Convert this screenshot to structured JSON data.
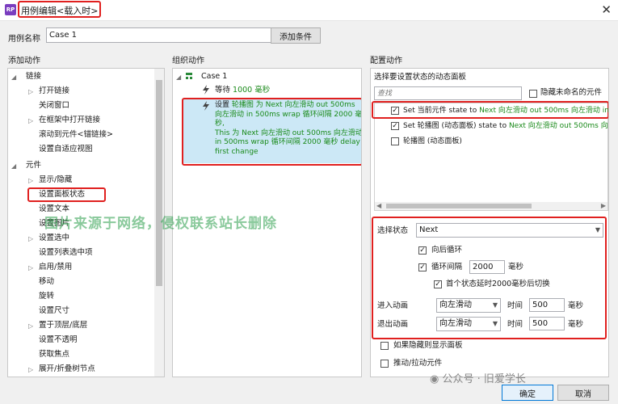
{
  "window": {
    "title": "用例编辑<载入时>",
    "app_icon": "RP",
    "close_glyph": "✕"
  },
  "case_name": {
    "label": "用例名称",
    "value": "Case 1",
    "add_condition": "添加条件"
  },
  "sections": {
    "add_action": "添加动作",
    "organize_action": "组织动作",
    "configure_action": "配置动作"
  },
  "left_tree": [
    {
      "label": "链接",
      "expand": "◢"
    },
    {
      "label": "打开链接",
      "expand": "▷"
    },
    {
      "label": "关闭窗口",
      "expand": ""
    },
    {
      "label": "在框架中打开链接",
      "expand": "▷"
    },
    {
      "label": "滚动到元件<锚链接>",
      "expand": ""
    },
    {
      "label": "设置自适应视图",
      "expand": ""
    },
    {
      "label": "元件",
      "expand": "◢"
    },
    {
      "label": "显示/隐藏",
      "expand": "▷"
    },
    {
      "label": "设置面板状态",
      "expand": ""
    },
    {
      "label": "设置文本",
      "expand": ""
    },
    {
      "label": "设置图片",
      "expand": ""
    },
    {
      "label": "设置选中",
      "expand": "▷"
    },
    {
      "label": "设置列表选中项",
      "expand": ""
    },
    {
      "label": "启用/禁用",
      "expand": "▷"
    },
    {
      "label": "移动",
      "expand": ""
    },
    {
      "label": "旋转",
      "expand": ""
    },
    {
      "label": "设置尺寸",
      "expand": ""
    },
    {
      "label": "置于顶层/底层",
      "expand": "▷"
    },
    {
      "label": "设置不透明",
      "expand": ""
    },
    {
      "label": "获取焦点",
      "expand": ""
    },
    {
      "label": "展开/折叠树节点",
      "expand": "▷"
    }
  ],
  "middle": {
    "case_label": "Case 1",
    "wait_prefix": "等待",
    "wait_value": "1000 毫秒",
    "action_line1_prefix": "设置",
    "action_line1": "轮播图 为 Next 向左滑动 out 500ms",
    "action_line2": "向左滑动 in 500ms wrap 循环间隔 2000 毫",
    "action_line3": "秒,",
    "action_line4": "This 为 Next 向左滑动 out 500ms 向左滑动",
    "action_line5": "in 500ms wrap 循环间隔 2000 毫秒 delay",
    "action_line6": "first change"
  },
  "right": {
    "select_panel_label": "选择要设置状态的动态面板",
    "search_placeholder": "查找",
    "hide_unnamed": "隐藏未命名的元件",
    "panel_rows": [
      {
        "prefix": "Set 当前元件 state to ",
        "colored": "Next 向左滑动 out 500ms 向左滑动 in",
        "checked": "✓"
      },
      {
        "prefix": "Set 轮播图 (动态面板) state to ",
        "colored": "Next 向左滑动 out 500ms 向",
        "checked": "✓"
      },
      {
        "prefix": "轮播图 (动态面板)",
        "colored": "",
        "checked": ""
      }
    ],
    "select_state_label": "选择状态",
    "select_state_value": "Next",
    "loop_back": "向后循环",
    "loop_interval": "循环间隔",
    "loop_interval_value": "2000",
    "ms": "毫秒",
    "first_delay": "首个状态延时2000毫秒后切换",
    "enter_anim_label": "进入动画",
    "exit_anim_label": "退出动画",
    "anim_value": "向左滑动",
    "time_label": "时间",
    "time_value": "500",
    "show_if_hidden": "如果隐藏则显示面板",
    "push_pull": "推动/拉动元件"
  },
  "watermark": "图片来源于网络，侵权联系站长删除",
  "wechat_badge": "公众号 · 旧爱学长",
  "buttons": {
    "ok": "确定",
    "cancel": "取消"
  },
  "colors": {
    "highlight_red": "#e0201f",
    "green_text": "#1a8a1a",
    "selection_blue": "#cce8f6"
  }
}
